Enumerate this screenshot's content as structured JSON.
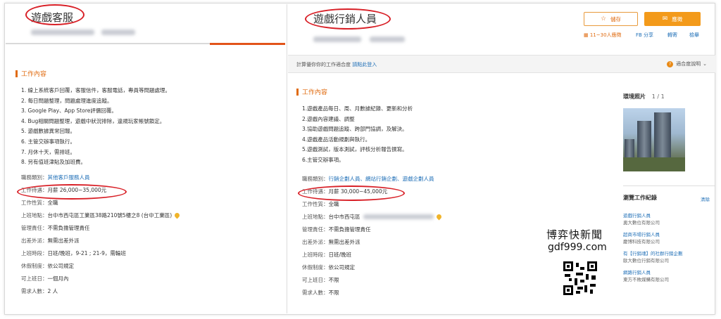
{
  "left": {
    "title": "遊戲客服",
    "section_title": "工作內容",
    "duties": [
      "1. 線上系統客戶回覆，客服信件，客服電話，專員等問題處理。",
      "2. 每日問題整理，問題處理進度追蹤。",
      "3. Google Play、App Store評價回覆。",
      "4. Bug相關問題整理，遊戲中狀況排除，違規玩家帳號鎖定。",
      "5. 遊戲數據異常回報。",
      "6. 主管交辦事項執行。",
      "7. 月休十天，需排班。",
      "8. 另有值班津貼及加班費。"
    ],
    "fields": [
      {
        "k": "職務類別：",
        "v": "其他客戶服務人員",
        "link": true
      },
      {
        "k": "工作待遇：",
        "v": "月薪 26,000~35,000元"
      },
      {
        "k": "工作性質：",
        "v": "全職"
      },
      {
        "k": "上班地點：",
        "v": "台中市西屯區工業區38路210號5樓之8 (台中工業區)"
      },
      {
        "k": "管理責任：",
        "v": "不需負擔管理責任"
      },
      {
        "k": "出差外派：",
        "v": "無需出差外派"
      },
      {
        "k": "上班時段：",
        "v": "日班/晚班，9-21 ; 21-9，需輪班"
      },
      {
        "k": "休假制度：",
        "v": "依公司規定"
      },
      {
        "k": "可上班日：",
        "v": "一個月內"
      },
      {
        "k": "需求人數：",
        "v": "2 人"
      }
    ]
  },
  "right": {
    "title": "遊戲行銷人員",
    "save_label": "儲存",
    "apply_label": "應徵",
    "meta": [
      "11~30人應徵",
      "FB 分享",
      "轉寄",
      "檢舉"
    ],
    "fit_prompt": "計算優你你的工作適合度",
    "login_link": "請點此登入",
    "fit_help": "適合度說明",
    "section_title": "工作內容",
    "duties": [
      "1.遊戲產品每日、周、月數據紀錄、更新和分析",
      "2.遊戲內容建議、調整",
      "3.協助遊戲問題追蹤、跨部門協調，及解決。",
      "4.遊戲產品活動規劃與執行。",
      "5.遊戲測試，版本測試，評核分析報告撰寫。",
      "6.主管交辦事項。"
    ],
    "fields": [
      {
        "k": "職務類別：",
        "v": "行銷企劃人員、網站行銷企劃、遊戲企劃人員",
        "link": true
      },
      {
        "k": "工作待遇：",
        "v": "月薪 30,000~45,000元"
      },
      {
        "k": "工作性質：",
        "v": "全職"
      },
      {
        "k": "上班地點：",
        "v": "台中市西屯區"
      },
      {
        "k": "管理責任：",
        "v": "不需負擔管理責任"
      },
      {
        "k": "出差外派：",
        "v": "無需出差外派"
      },
      {
        "k": "上班時段：",
        "v": "日班/晚班"
      },
      {
        "k": "休假制度：",
        "v": "依公司規定"
      },
      {
        "k": "可上班日：",
        "v": "不限"
      },
      {
        "k": "需求人數：",
        "v": "不限"
      }
    ],
    "photos_title": "環境照片",
    "photos_count": "1 / 1",
    "history_title": "瀏覽工作紀錄",
    "history_clear": "清除",
    "history": [
      {
        "title": "遊戲行銷人員",
        "company": "奧大數位有限公司"
      },
      {
        "title": "超商市場行銷人員",
        "company": "慶博科技有限公司"
      },
      {
        "title": "有【行銷魂】的社群行銷企劃",
        "company": "歐大數位行銷有限公司"
      },
      {
        "title": "網路行銷人員",
        "company": "東方不敗媒購有限公司"
      }
    ]
  },
  "watermark": {
    "name": "博弈快新聞",
    "url": "gdf999.com"
  }
}
